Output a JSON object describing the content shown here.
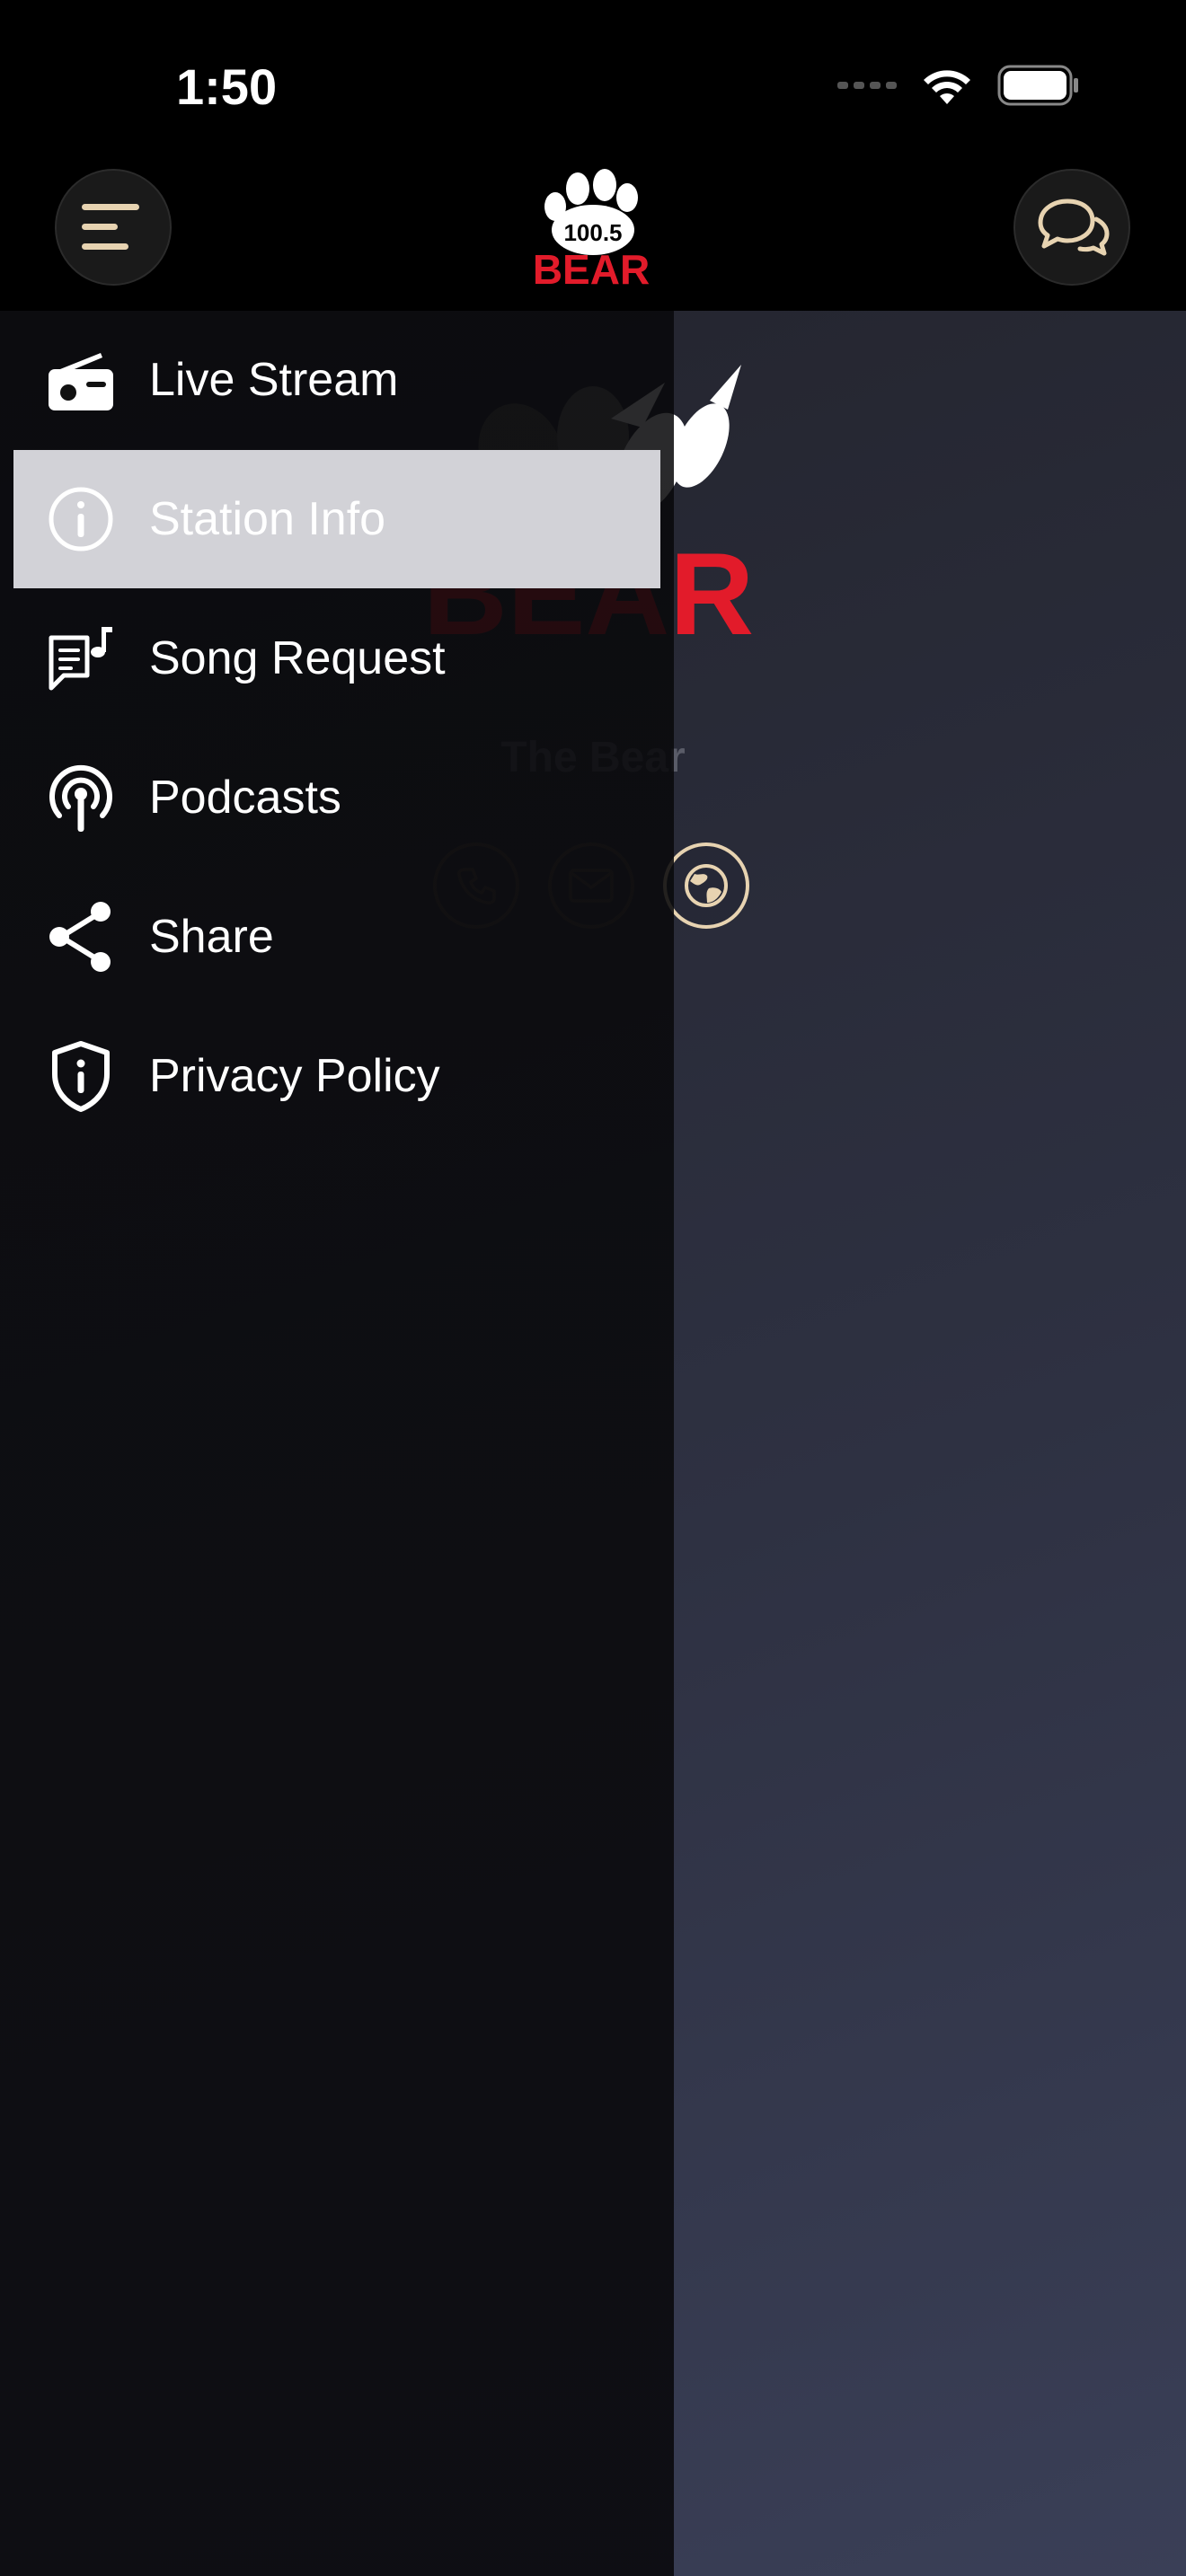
{
  "status_bar": {
    "time": "1:50",
    "icons": [
      "cellular-icon",
      "wifi-icon",
      "battery-icon"
    ]
  },
  "top_bar": {
    "menu_icon": "menu-icon",
    "chat_icon": "chat-icon",
    "logo_text_top": "100.5",
    "logo_text_bottom": "BEAR"
  },
  "content": {
    "logo_text": "BEAR",
    "station_name": "The Bear",
    "contacts": [
      "phone-icon",
      "mail-icon",
      "globe-icon"
    ]
  },
  "drawer": {
    "items": [
      {
        "label": "Live Stream",
        "icon": "radio-icon",
        "active": false
      },
      {
        "label": "Station Info",
        "icon": "info-icon",
        "active": true
      },
      {
        "label": "Song Request",
        "icon": "song-request-icon",
        "active": false
      },
      {
        "label": "Podcasts",
        "icon": "podcast-icon",
        "active": false
      },
      {
        "label": "Share",
        "icon": "share-icon",
        "active": false
      },
      {
        "label": "Privacy Policy",
        "icon": "privacy-shield-icon",
        "active": false
      }
    ]
  },
  "colors": {
    "accent": "#e7d3b1",
    "brand_red": "#e21b2a",
    "active_row": "#d2d2d7"
  }
}
